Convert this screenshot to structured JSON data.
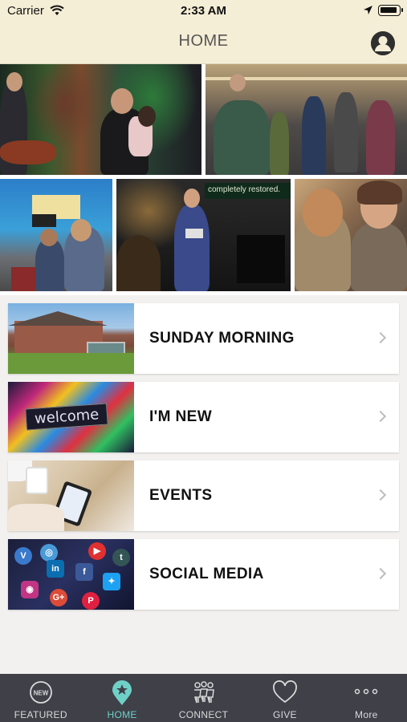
{
  "status_bar": {
    "carrier": "Carrier",
    "time": "2:33 AM"
  },
  "nav": {
    "title": "HOME"
  },
  "collage": {
    "sign_text": "completely restored."
  },
  "menu": [
    {
      "label": "SUNDAY MORNING",
      "thumb_icon": "church-building-image"
    },
    {
      "label": "I'M NEW",
      "thumb_icon": "welcome-sign-image",
      "thumb_text": "welcome"
    },
    {
      "label": "EVENTS",
      "thumb_icon": "phone-calendar-image"
    },
    {
      "label": "SOCIAL MEDIA",
      "thumb_icon": "social-apps-image"
    }
  ],
  "tabs": [
    {
      "label": "FEATURED",
      "icon": "new-badge-icon",
      "active": false
    },
    {
      "label": "HOME",
      "icon": "home-star-pin-icon",
      "active": true
    },
    {
      "label": "CONNECT",
      "icon": "people-group-icon",
      "active": false
    },
    {
      "label": "GIVE",
      "icon": "heart-icon",
      "active": false
    },
    {
      "label": "More",
      "icon": "more-dots-icon",
      "active": false
    }
  ],
  "colors": {
    "header_bg": "#f5eed6",
    "tab_bar_bg": "#3f4048",
    "active_tab": "#6fd0c8",
    "page_bg": "#f2f1ef"
  }
}
